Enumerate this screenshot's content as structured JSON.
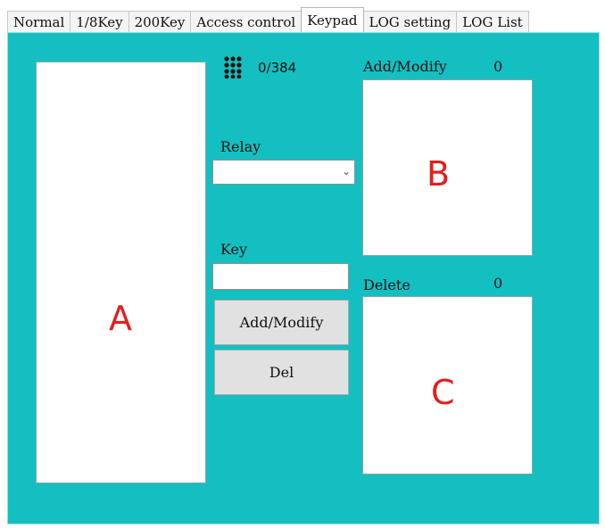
{
  "tabs": [
    {
      "label": "Normal"
    },
    {
      "label": "1/8Key"
    },
    {
      "label": "200Key"
    },
    {
      "label": "Access control"
    },
    {
      "label": "Keypad"
    },
    {
      "label": "LOG setting"
    },
    {
      "label": "LOG List"
    }
  ],
  "active_tab": "Keypad",
  "keypad": {
    "counter": "0/384",
    "icon": "keypad-icon"
  },
  "relay": {
    "label": "Relay",
    "selected": ""
  },
  "key": {
    "label": "Key",
    "value": ""
  },
  "buttons": {
    "add_modify": "Add/Modify",
    "del": "Del"
  },
  "add_modify_list": {
    "title": "Add/Modify",
    "count": "0"
  },
  "delete_list": {
    "title": "Delete",
    "count": "0"
  },
  "annotations": {
    "a": "A",
    "b": "B",
    "c": "C"
  },
  "colors": {
    "panel": "#14bfc1",
    "annotation": "#e51d1d"
  }
}
